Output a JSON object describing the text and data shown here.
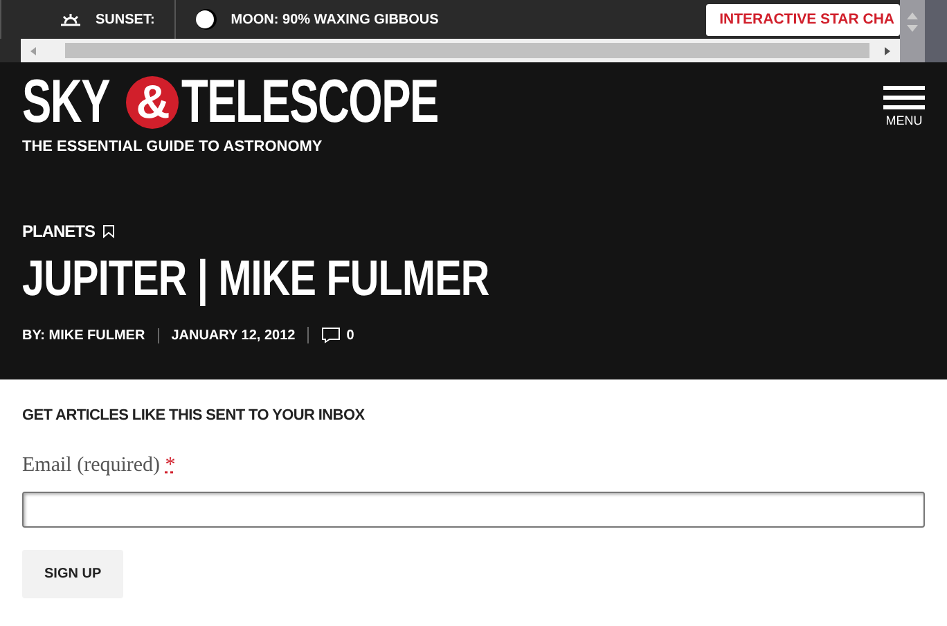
{
  "top_bar": {
    "sunset": "SUNSET:",
    "moon": "MOON: 90% WAXING GIBBOUS",
    "star_chart_button": "INTERACTIVE STAR CHA"
  },
  "logo": {
    "sky": "SKY",
    "ampersand": "&",
    "telescope": "TELESCOPE",
    "tagline": "THE ESSENTIAL GUIDE TO ASTRONOMY"
  },
  "menu": {
    "label": "MENU"
  },
  "article": {
    "category": "PLANETS",
    "title": "JUPITER | MIKE FULMER",
    "author": "BY: MIKE FULMER",
    "date": "JANUARY 12, 2012",
    "comments": "0"
  },
  "signup": {
    "heading": "GET ARTICLES LIKE THIS SENT TO YOUR INBOX",
    "email_label": "Email (required)",
    "required_mark": "*",
    "button": "SIGN UP"
  }
}
